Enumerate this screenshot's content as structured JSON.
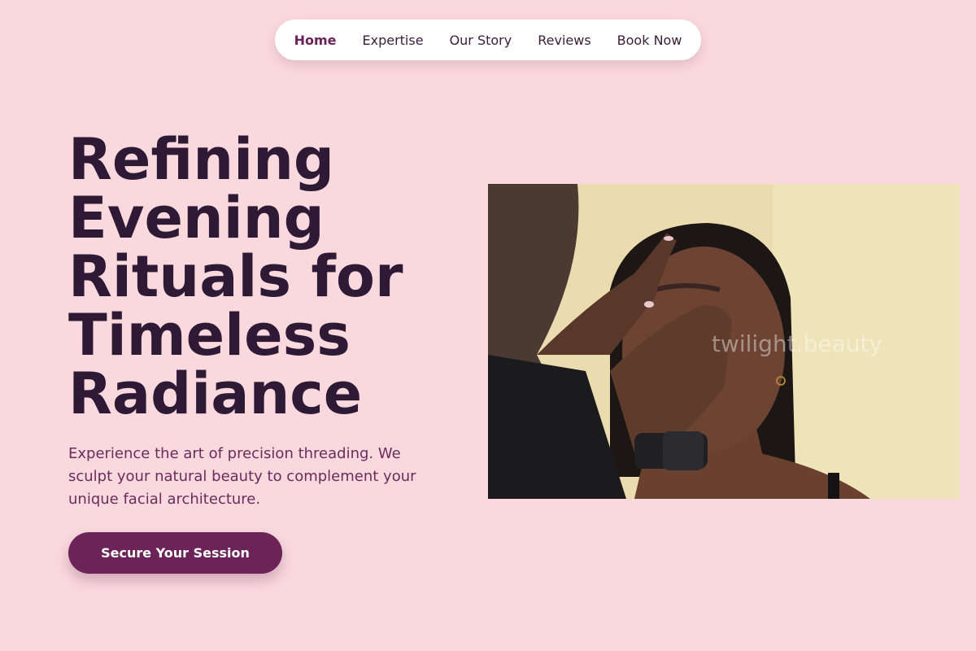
{
  "nav": {
    "items": [
      {
        "label": "Home",
        "active": true
      },
      {
        "label": "Expertise"
      },
      {
        "label": "Our Story"
      },
      {
        "label": "Reviews"
      },
      {
        "label": "Book Now"
      }
    ]
  },
  "hero": {
    "title_lines": [
      "Refining",
      "Evening",
      "Rituals for",
      "Timeless",
      "Radiance"
    ],
    "subtitle": "Experience the art of precision threading. We sculpt your natural beauty to complement your unique facial architecture.",
    "cta_label": "Secure Your Session"
  },
  "photo": {
    "watermark": "twilight.beauty"
  },
  "colors": {
    "background": "#f9d9de",
    "accent": "#6b2358",
    "title": "#2e1a35",
    "subtitle": "#6c2b5b"
  }
}
